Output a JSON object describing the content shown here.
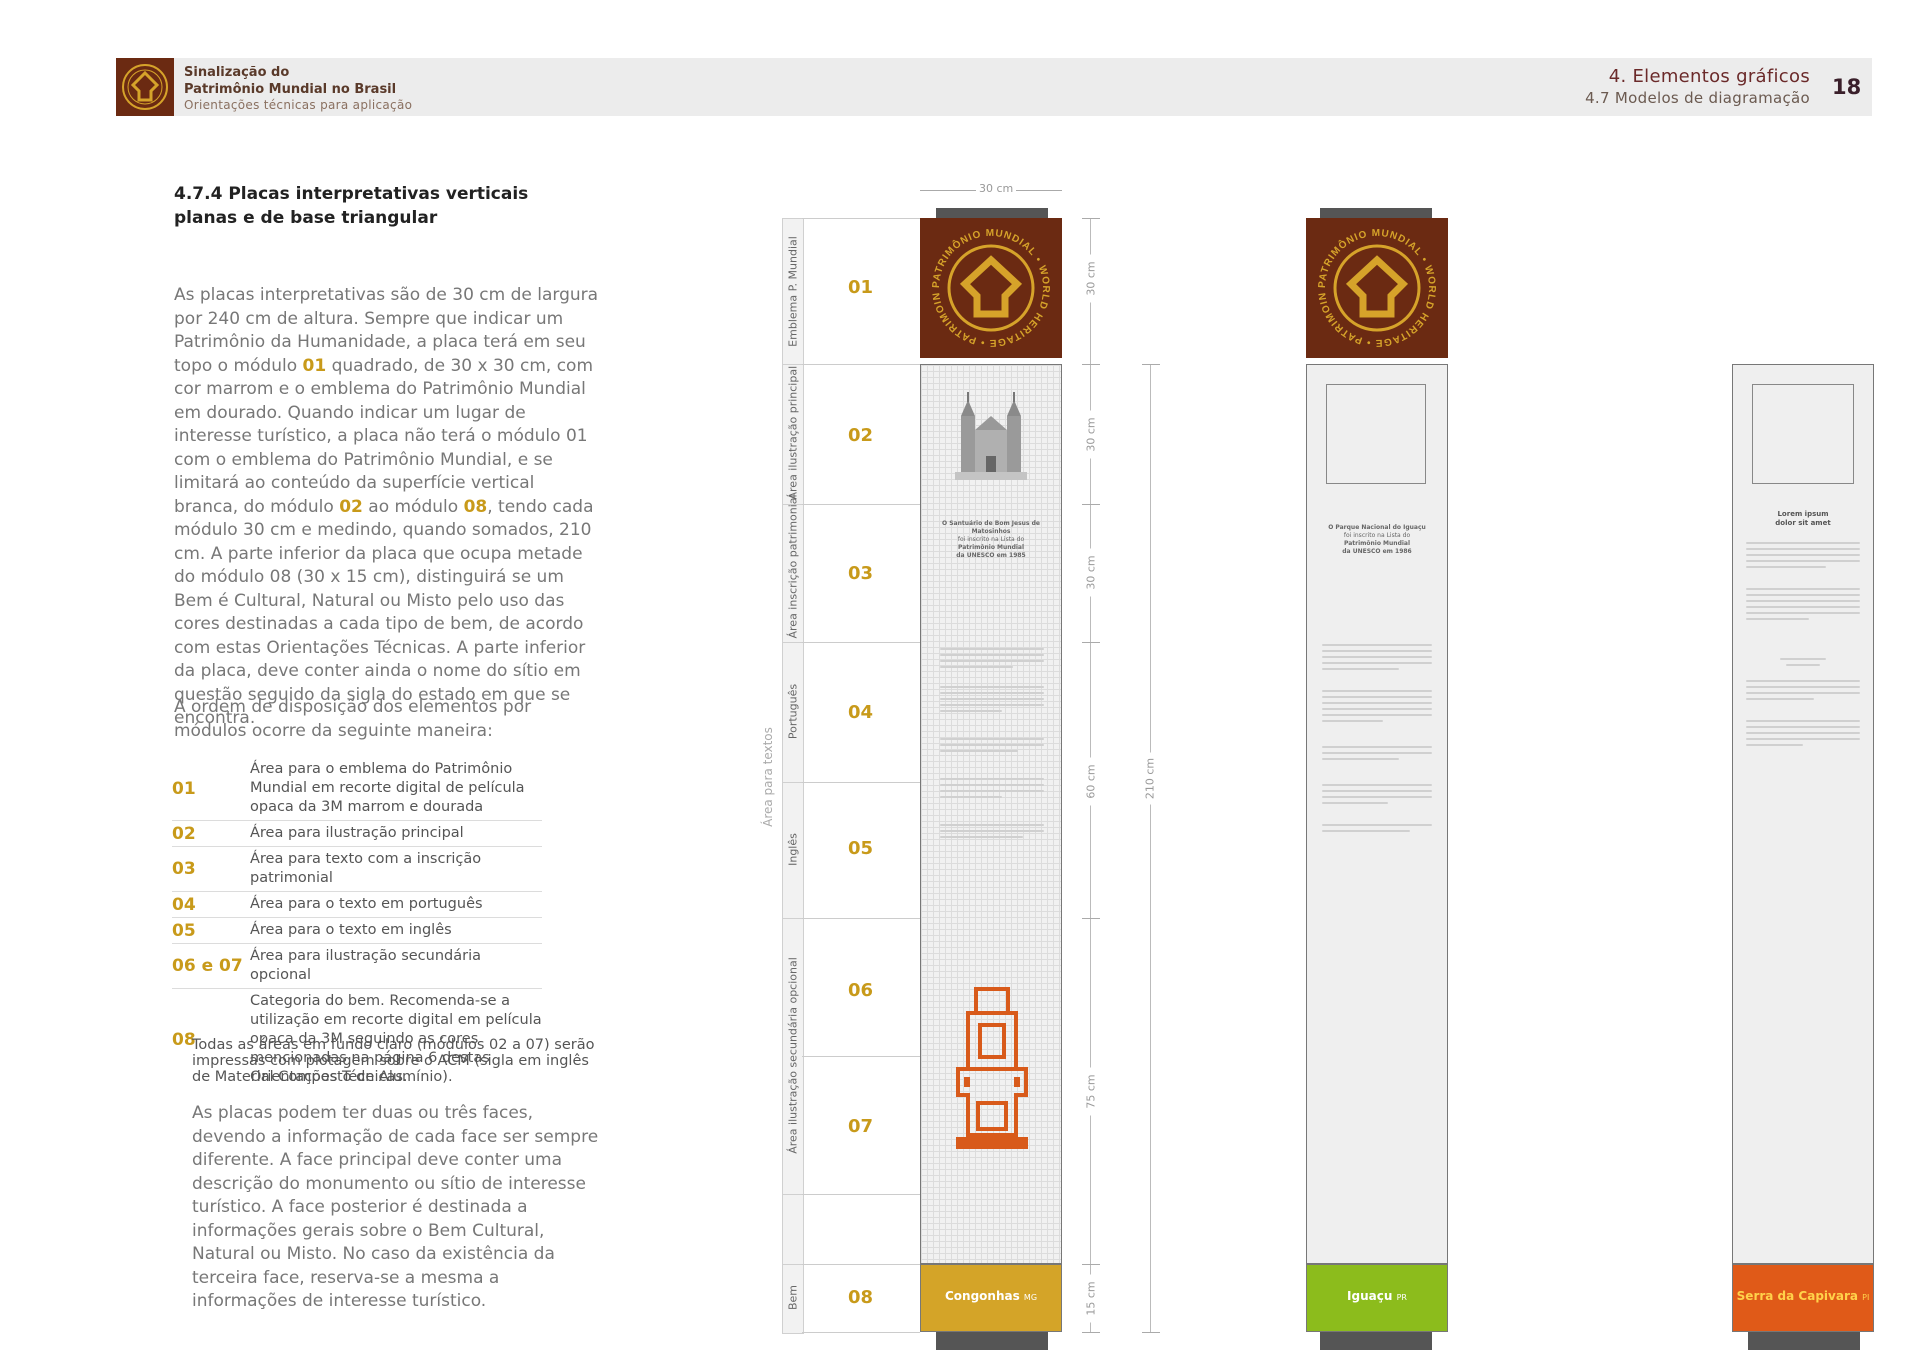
{
  "header": {
    "title_line1": "Sinalização do",
    "title_line2": "Patrimônio Mundial no Brasil",
    "subtitle": "Orientações técnicas para aplicação",
    "section": "4. Elementos gráficos",
    "subsection": "4.7 Modelos de diagramação",
    "page": "18"
  },
  "content": {
    "heading_line1": "4.7.4 Placas interpretativas verticais",
    "heading_line2": "planas e de base triangular",
    "p1_a": "As placas interpretativas são de 30 cm de largura por 240 cm de altura. Sempre que indicar um Patrimônio da Humanidade, a placa terá em seu topo o módulo ",
    "p1_hl1": "01",
    "p1_b": " quadrado, de 30 x 30 cm, com cor marrom e o emblema do Patrimônio Mundial em dourado. Quando indicar um lugar de interesse turístico, a placa não terá o módulo 01 com o emblema do Patrimônio Mundial, e se limitará ao conteúdo da superfície vertical branca, do módulo ",
    "p1_hl2": "02",
    "p1_c": " ao módulo ",
    "p1_hl3": "08",
    "p1_d": ", tendo cada módulo 30 cm e medindo, quando somados, 210 cm. A parte inferior da placa que ocupa metade do módulo 08 (30 x 15 cm), distinguirá se um Bem é Cultural, Natural ou Misto pelo uso das cores destinadas a cada tipo de bem, de acordo com estas Orientações Técnicas. A parte inferior da placa, deve conter ainda o nome do sítio em questão seguido da sigla do estado em que se encontra.",
    "p2": "A ordem de disposição dos elementos por módulos ocorre da seguinte maneira:",
    "list": [
      {
        "num": "01",
        "text": "Área para o emblema do Patrimônio Mundial em recorte digital de película opaca da 3M marrom e dourada"
      },
      {
        "num": "02",
        "text": "Área para ilustração principal"
      },
      {
        "num": "03",
        "text": "Área para texto com a inscrição patrimonial"
      },
      {
        "num": "04",
        "text": "Área para o texto em português"
      },
      {
        "num": "05",
        "text": "Área para o texto em inglês"
      },
      {
        "num": "06 e 07",
        "text": "Área para ilustração secundária opcional"
      },
      {
        "num": "08",
        "text": "Categoria do bem. Recomenda-se a utilização em recorte digital em película opaca da 3M seguindo as cores mencionadas na página 6 destas Orientações Técnicas."
      }
    ],
    "note": "Todas as áreas em fundo claro (módulos 02 a 07) serão impressas com plotagem sobre o ACM (sigla em inglês de Material Composto de Alumínio).",
    "p3": "As placas podem ter duas ou três faces, devendo a informação de cada face ser sempre diferente. A face principal deve conter uma descrição do monumento ou sítio de interesse turístico. A face posterior é destinada a informações gerais sobre o Bem Cultural, Natural ou Misto. No caso da existência da terceira face, reserva-se a mesma a informações de interesse turístico."
  },
  "diagram": {
    "row_labels": [
      "Emblema P. Mundial",
      "Área ilustração principal",
      "Área inscrição patrimonial",
      "Português",
      "Inglês",
      "Área ilustração secundária opcional",
      "Bem"
    ],
    "group_label": "Área para textos",
    "modules": [
      "01",
      "02",
      "03",
      "04",
      "05",
      "06",
      "07",
      "08"
    ],
    "dims": {
      "width": "30 cm",
      "d1": "30 cm",
      "d2": "30 cm",
      "d3": "30 cm",
      "d4": "60 cm",
      "d5": "75 cm",
      "d6": "15 cm",
      "total": "210 cm"
    },
    "plate1": {
      "inscription_title": "O Santuário de Bom Jesus de Matosinhos",
      "inscription_l1": "foi inscrito na Lista do",
      "inscription_l2": "Patrimônio Mundial",
      "inscription_l3": "da UNESCO em 1985",
      "site": "Congonhas",
      "state": "MG",
      "color": "#d4a428"
    },
    "plate2": {
      "inscription_title": "O Parque Nacional do Iguaçu",
      "inscription_l1": "foi inscrito na Lista do",
      "inscription_l2": "Patrimônio Mundial",
      "inscription_l3": "da UNESCO em 1986",
      "site": "Iguaçu",
      "state": "PR",
      "color": "#8cbc1c"
    },
    "plate3": {
      "inscription_title": "Lorem ipsum dolor sit amet",
      "site": "Serra da Capivara",
      "state": "PI",
      "color": "#e05a18"
    },
    "emblem_text": "PATRIMÔNIO MUNDIAL • WORLD HERITAGE • PATRIMOINE MONDIAL",
    "colors": {
      "brown": "#6b2a12",
      "gold": "#c89a1a"
    }
  }
}
